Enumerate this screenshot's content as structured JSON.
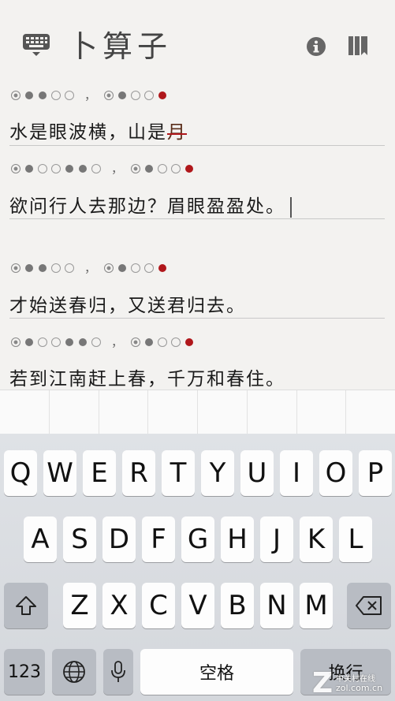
{
  "header": {
    "title": "卜算子",
    "left_icon": "keyboard-icon",
    "right_icons": [
      "info-icon",
      "book-icon"
    ]
  },
  "poem": {
    "lines": [
      {
        "pattern": [
          "ping",
          "dot",
          "dot",
          "open",
          "open",
          "comma",
          "ping",
          "dot",
          "open",
          "open",
          "rhyme"
        ],
        "text": "水是眼波横，山是",
        "struck_text": "月"
      },
      {
        "pattern": [
          "ping",
          "dot",
          "open",
          "open",
          "dot",
          "dot",
          "open",
          "comma",
          "ping",
          "dot",
          "open",
          "open",
          "rhyme"
        ],
        "text": "欲问行人去那边？眉眼盈盈处。"
      },
      {
        "pattern": [
          "ping",
          "dot",
          "dot",
          "open",
          "open",
          "comma",
          "ping",
          "dot",
          "open",
          "open",
          "rhyme"
        ],
        "text": "才始送春归，又送君归去。"
      },
      {
        "pattern": [
          "ping",
          "dot",
          "open",
          "open",
          "dot",
          "dot",
          "open",
          "comma",
          "ping",
          "dot",
          "open",
          "open",
          "rhyme"
        ],
        "text": "若到江南赶上春，千万和春住。"
      }
    ],
    "comma_char": "，",
    "rhyme_color": "#b0171b"
  },
  "keyboard": {
    "row1": [
      "Q",
      "W",
      "E",
      "R",
      "T",
      "Y",
      "U",
      "I",
      "O",
      "P"
    ],
    "row2": [
      "A",
      "S",
      "D",
      "F",
      "G",
      "H",
      "J",
      "K",
      "L"
    ],
    "row3": [
      "Z",
      "X",
      "C",
      "V",
      "B",
      "N",
      "M"
    ],
    "numbers_label": "123",
    "space_label": "空格",
    "return_label": "换行",
    "shift_icon": "shift-icon",
    "delete_icon": "delete-icon",
    "globe_icon": "globe-icon",
    "mic_icon": "microphone-icon"
  },
  "watermark": {
    "logo": "Z",
    "text_cn": "中关村在线",
    "url": "zol.com.cn"
  }
}
